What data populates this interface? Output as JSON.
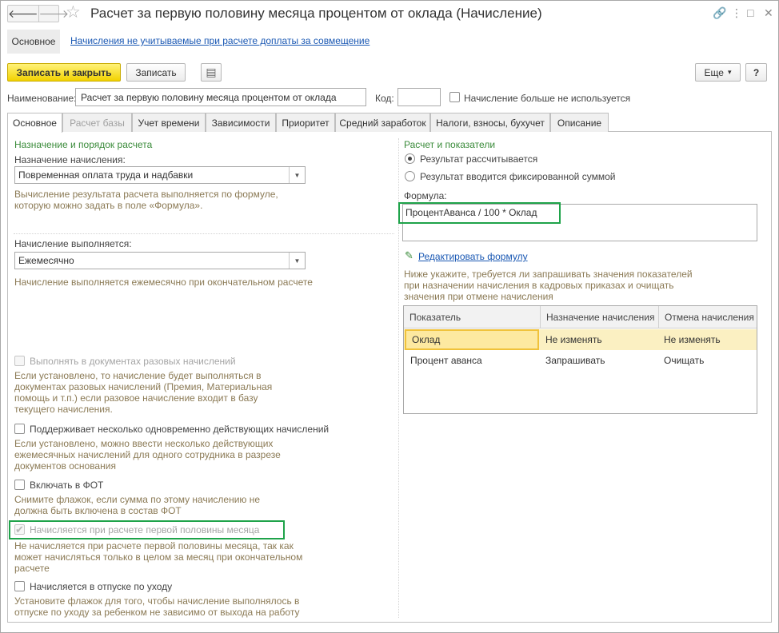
{
  "window": {
    "title": "Расчет за первую половину месяца процентом от оклада (Начисление)",
    "nav_back": "🡐",
    "nav_forward": "🡒",
    "star": "☆",
    "link_icon": "🔗",
    "menu_icon": "⋮",
    "restore_icon": "□",
    "close_icon": "✕"
  },
  "top_nav": {
    "main_tab": "Основное",
    "link": "Начисления не учитываемые при расчете доплаты за совмещение"
  },
  "toolbar": {
    "save_close": "Записать и закрыть",
    "save": "Записать",
    "report_icon": "▤",
    "more": "Еще",
    "more_arrow": "▾",
    "help": "?"
  },
  "header_fields": {
    "name_label": "Наименование:",
    "name_value": "Расчет за первую половину месяца процентом от оклада",
    "code_label": "Код:",
    "code_value": "",
    "unused_label": "Начисление больше не используется"
  },
  "tabs": [
    {
      "label": "Основное"
    },
    {
      "label": "Расчет базы"
    },
    {
      "label": "Учет времени"
    },
    {
      "label": "Зависимости"
    },
    {
      "label": "Приоритет"
    },
    {
      "label": "Средний заработок"
    },
    {
      "label": "Налоги, взносы, бухучет"
    },
    {
      "label": "Описание"
    }
  ],
  "left": {
    "section_title": "Назначение и порядок расчета",
    "purpose_label": "Назначение начисления:",
    "purpose_value": "Повременная оплата труда и надбавки",
    "purpose_hint_1": "Вычисление результата расчета выполняется по формуле,",
    "purpose_hint_2": "которую можно задать в поле «Формула».",
    "exec_label": "Начисление выполняется:",
    "exec_value": "Ежемесячно",
    "exec_hint": "Начисление выполняется ежемесячно при окончательном расчете",
    "one_time_label": "Выполнять в документах разовых начислений",
    "one_time_hint": [
      "Если установлено, то начисление будет выполняться в",
      "документах разовых начислений (Премия, Материальная",
      "помощь и т.п.) если разовое начисление входит в базу",
      "текущего начисления."
    ],
    "multi_label": "Поддерживает несколько одновременно действующих начислений",
    "multi_hint": [
      "Если установлено, можно ввести несколько действующих",
      "ежемесячных начислений для одного сотрудника в разрезе",
      "документов основания"
    ],
    "fot_label": "Включать в ФОТ",
    "fot_hint": [
      "Снимите флажок, если сумма по этому начислению не",
      "должна быть включена в состав ФОТ"
    ],
    "first_half_label": "Начисляется при расчете первой половины месяца",
    "first_half_checked": true,
    "first_half_hint": [
      "Не начисляется при расчете первой половины месяца, так как",
      "может начисляться только в целом за месяц при окончательном",
      "расчете"
    ],
    "leave_label": "Начисляется в отпуске по уходу",
    "leave_hint": [
      "Установите флажок для того, чтобы начисление выполнялось в",
      "отпуске по уходу за ребенком не зависимо от выхода на работу"
    ]
  },
  "right": {
    "section_title": "Расчет и показатели",
    "radio_calc": "Результат рассчитывается",
    "radio_fixed": "Результат вводится фиксированной суммой",
    "radio_selected": "calc",
    "formula_label": "Формула:",
    "formula_value": "ПроцентАванса / 100 * Оклад",
    "edit_formula_icon": "✎",
    "edit_formula": "Редактировать формулу",
    "indicators_hint": [
      "Ниже укажите, требуется ли запрашивать значения показателей",
      "при назначении начисления в кадровых приказах и очищать",
      "значения при отмене начисления"
    ],
    "table": {
      "headers": [
        "Показатель",
        "Назначение начисления",
        "Отмена начисления"
      ],
      "rows": [
        [
          "Оклад",
          "Не изменять",
          "Не изменять"
        ],
        [
          "Процент аванса",
          "Запрашивать",
          "Очищать"
        ]
      ]
    }
  },
  "colors": {
    "primary_button": "#f2d200",
    "highlight_frame": "#1fa34a",
    "section_title": "#3a8b3a",
    "hint_text": "#8b7a55",
    "link": "#1a58b3",
    "selected_row": "#fbf0c2"
  }
}
